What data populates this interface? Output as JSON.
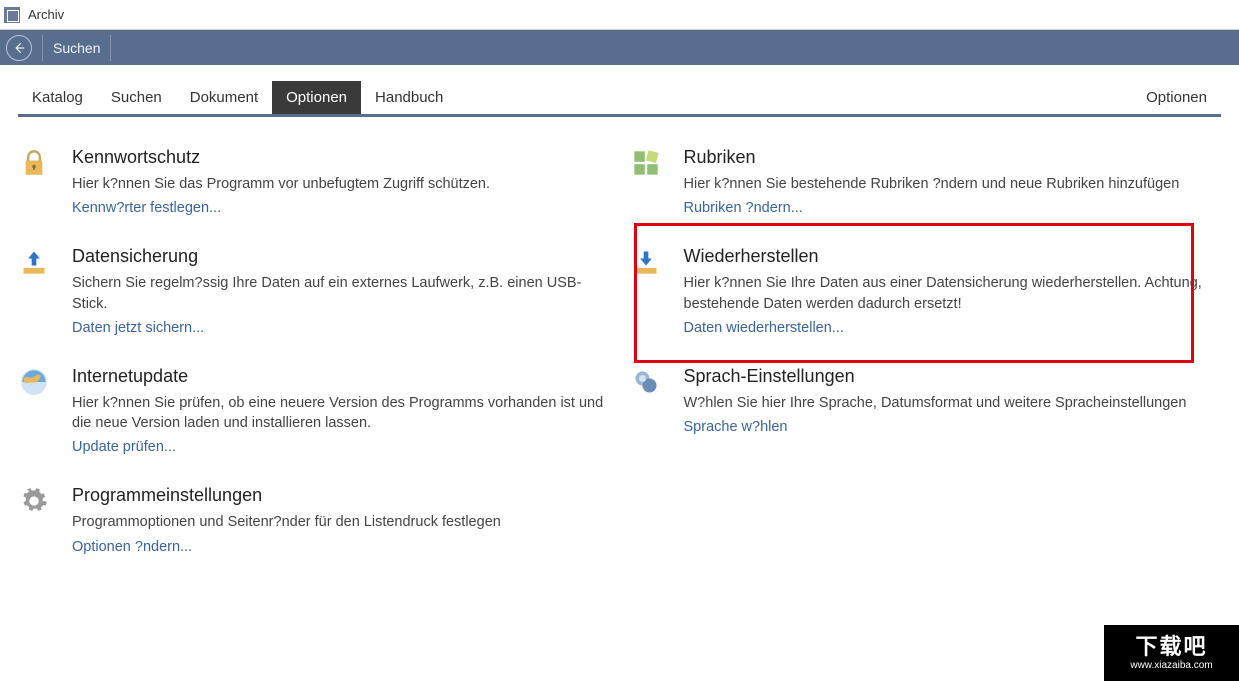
{
  "window": {
    "title": "Archiv"
  },
  "toolbar": {
    "search_label": "Suchen"
  },
  "tabs": {
    "items": [
      {
        "label": "Katalog"
      },
      {
        "label": "Suchen"
      },
      {
        "label": "Dokument"
      },
      {
        "label": "Optionen"
      },
      {
        "label": "Handbuch"
      }
    ],
    "right_label": "Optionen"
  },
  "options_left": [
    {
      "title": "Kennwortschutz",
      "desc": "Hier k?nnen Sie das Programm vor unbefugtem Zugriff schützen.",
      "link": "Kennw?rter festlegen..."
    },
    {
      "title": "Datensicherung",
      "desc": "Sichern Sie regelm?ssig Ihre Daten auf ein externes Laufwerk, z.B. einen USB-Stick.",
      "link": "Daten jetzt sichern..."
    },
    {
      "title": "Internetupdate",
      "desc": "Hier k?nnen Sie prüfen, ob eine neuere Version des Programms vorhanden ist und die neue Version laden und installieren lassen.",
      "link": "Update prüfen..."
    },
    {
      "title": "Programmeinstellungen",
      "desc": "Programmoptionen und Seitenr?nder für den Listendruck festlegen",
      "link": "Optionen ?ndern..."
    }
  ],
  "options_right": [
    {
      "title": "Rubriken",
      "desc": "Hier k?nnen Sie bestehende Rubriken ?ndern und neue Rubriken hinzufügen",
      "link": "Rubriken ?ndern..."
    },
    {
      "title": "Wiederherstellen",
      "desc": "Hier k?nnen Sie Ihre Daten aus einer Datensicherung wiederherstellen. Achtung, bestehende Daten werden dadurch ersetzt!",
      "link": "Daten wiederherstellen..."
    },
    {
      "title": "Sprach-Einstellungen",
      "desc": "W?hlen Sie hier Ihre Sprache, Datumsformat und weitere Spracheinstellungen",
      "link": "Sprache w?hlen"
    }
  ],
  "watermark": {
    "big": "下载吧",
    "small": "www.xiazaiba.com"
  }
}
